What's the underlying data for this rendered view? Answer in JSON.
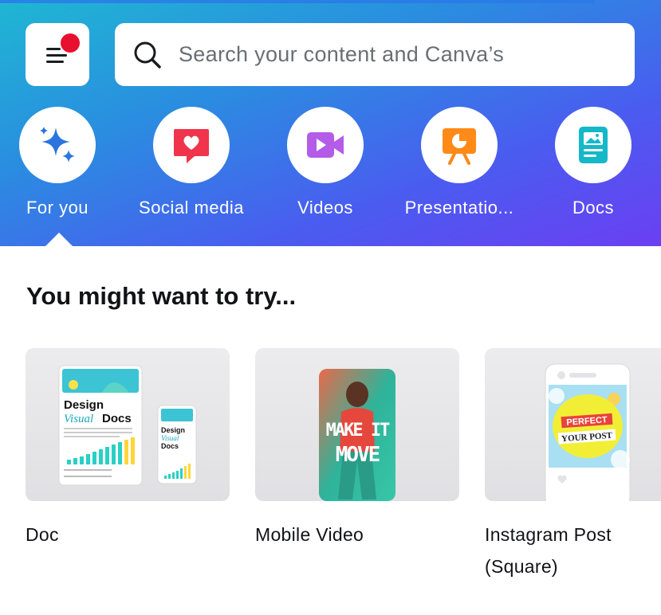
{
  "search": {
    "placeholder": "Search your content and Canva’s"
  },
  "categories": [
    {
      "label": "For you",
      "icon": "sparkle-icon"
    },
    {
      "label": "Social media",
      "icon": "heart-chat-icon"
    },
    {
      "label": "Videos",
      "icon": "video-camera-icon"
    },
    {
      "label": "Presentatio...",
      "icon": "presentation-icon"
    },
    {
      "label": "Docs",
      "icon": "doc-icon"
    }
  ],
  "section": {
    "title": "You might want to try..."
  },
  "cards": [
    {
      "label": "Doc",
      "thumb": {
        "line1": "Design",
        "line2": "Visual",
        "line3": "Docs"
      }
    },
    {
      "label": "Mobile Video",
      "thumb": {
        "line1": "MAKE IT",
        "line2": "MOVE"
      }
    },
    {
      "label": "Instagram Post (Square)",
      "thumb": {
        "line1": "PERFECT",
        "line2": "YOUR POST"
      }
    }
  ],
  "colors": {
    "hero_start": "#1fb7d3",
    "hero_end": "#6b3ff2",
    "notification_dot": "#e8102f"
  }
}
